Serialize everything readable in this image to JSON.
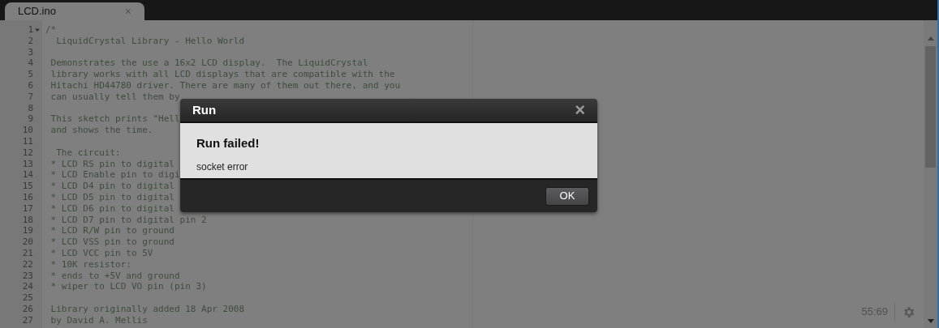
{
  "tabs": [
    {
      "label": "LCD.ino",
      "selected": true,
      "close": "×"
    }
  ],
  "editor": {
    "lines": [
      {
        "number": "1",
        "text": "/*",
        "foldable": true
      },
      {
        "number": "2",
        "text": "  LiquidCrystal Library - Hello World"
      },
      {
        "number": "3"
      },
      {
        "number": "4",
        "text": " Demonstrates the use a 16x2 LCD display.  The LiquidCrystal"
      },
      {
        "number": "5",
        "text": " library works with all LCD displays that are compatible with the"
      },
      {
        "number": "6",
        "text": " Hitachi HD44780 driver. There are many of them out there, and you"
      },
      {
        "number": "7",
        "text": " can usually tell them by"
      },
      {
        "number": "8"
      },
      {
        "number": "9",
        "text": " This sketch prints \"Hell"
      },
      {
        "number": "10",
        "text": " and shows the time."
      },
      {
        "number": "11"
      },
      {
        "number": "12",
        "text": "  The circuit:"
      },
      {
        "number": "13",
        "text": " * LCD RS pin to digital"
      },
      {
        "number": "14",
        "text": " * LCD Enable pin to digi"
      },
      {
        "number": "15",
        "text": " * LCD D4 pin to digital"
      },
      {
        "number": "16",
        "text": " * LCD D5 pin to digital"
      },
      {
        "number": "17",
        "text": " * LCD D6 pin to digital"
      },
      {
        "number": "18",
        "text": " * LCD D7 pin to digital pin 2"
      },
      {
        "number": "19",
        "text": " * LCD R/W pin to ground"
      },
      {
        "number": "20",
        "text": " * LCD VSS pin to ground"
      },
      {
        "number": "21",
        "text": " * LCD VCC pin to 5V"
      },
      {
        "number": "22",
        "text": " * 10K resistor:"
      },
      {
        "number": "23",
        "text": " * ends to +5V and ground"
      },
      {
        "number": "24",
        "text": " * wiper to LCD VO pin (pin 3)"
      },
      {
        "number": "25"
      },
      {
        "number": "26",
        "text": " Library originally added 18 Apr 2008"
      },
      {
        "number": "27",
        "text": " by David A. Mellis"
      }
    ],
    "cursor_position": "55:69"
  },
  "dialog": {
    "title": "Run",
    "close": "×",
    "heading": "Run failed!",
    "message": "socket error",
    "buttons": [
      "OK"
    ]
  }
}
